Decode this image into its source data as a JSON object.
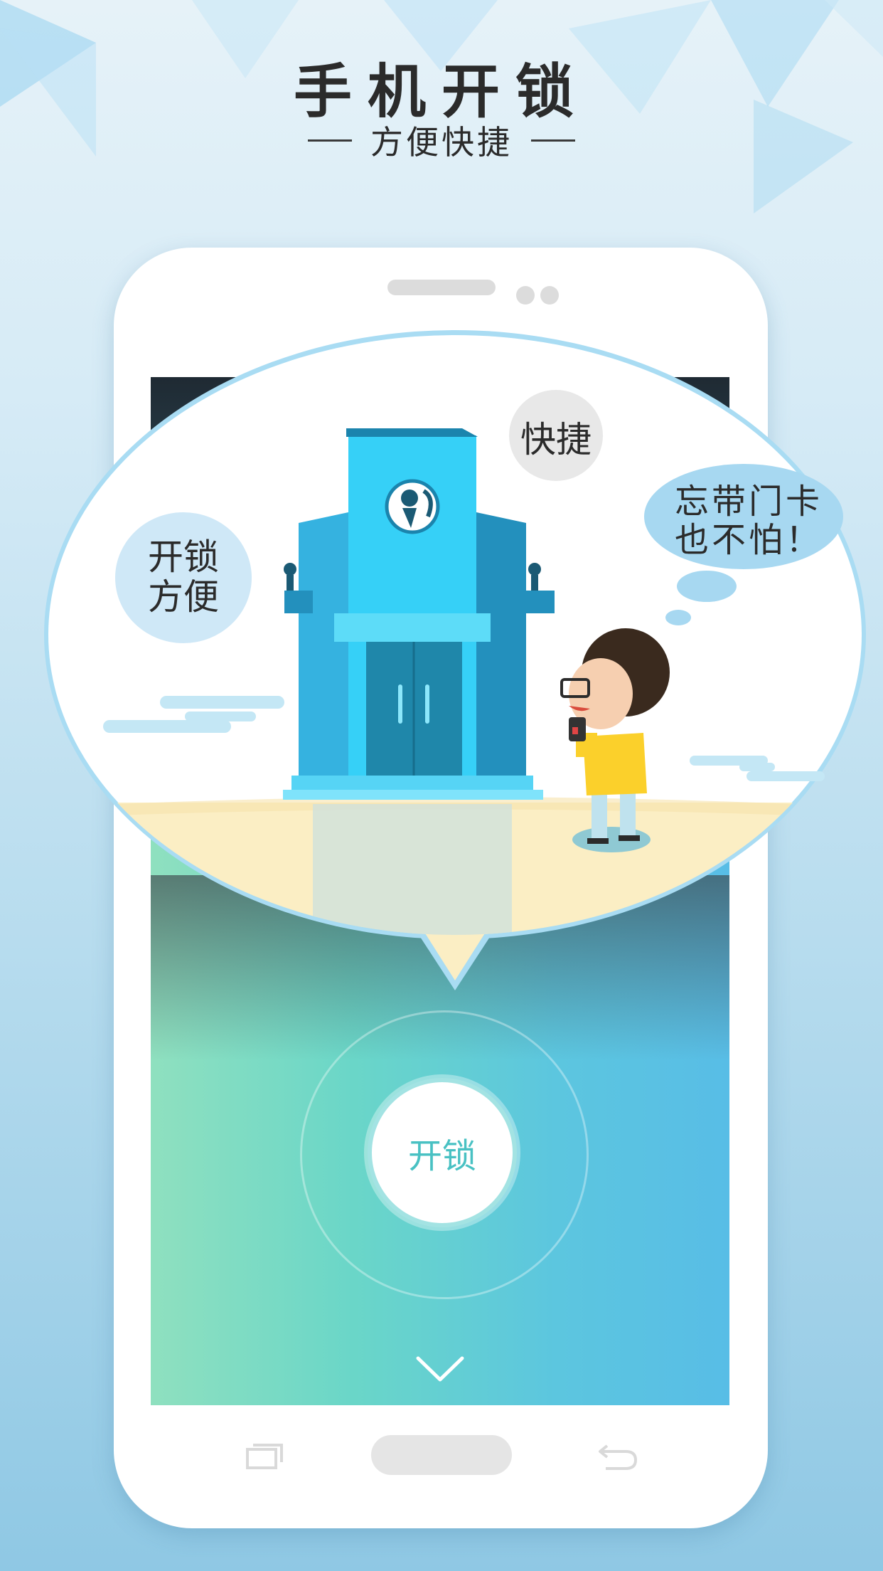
{
  "header": {
    "title": "手机开锁",
    "subtitle": "方便快捷"
  },
  "bubble": {
    "tag_fast": "快捷",
    "tag_convenient_line1": "开锁",
    "tag_convenient_line2": "方便",
    "thought_line1": "忘带门卡",
    "thought_line2": "也不怕！"
  },
  "screen": {
    "unlock_label": "开锁"
  },
  "icons": {
    "scroll_down": "chevron-down-icon",
    "recent_apps": "recent-apps-icon",
    "back": "back-icon"
  },
  "colors": {
    "accent_teal": "#49c1c3",
    "building_blue": "#2fc4ee",
    "bubble_border": "#a9dcf3",
    "ground": "#fbeec4"
  }
}
